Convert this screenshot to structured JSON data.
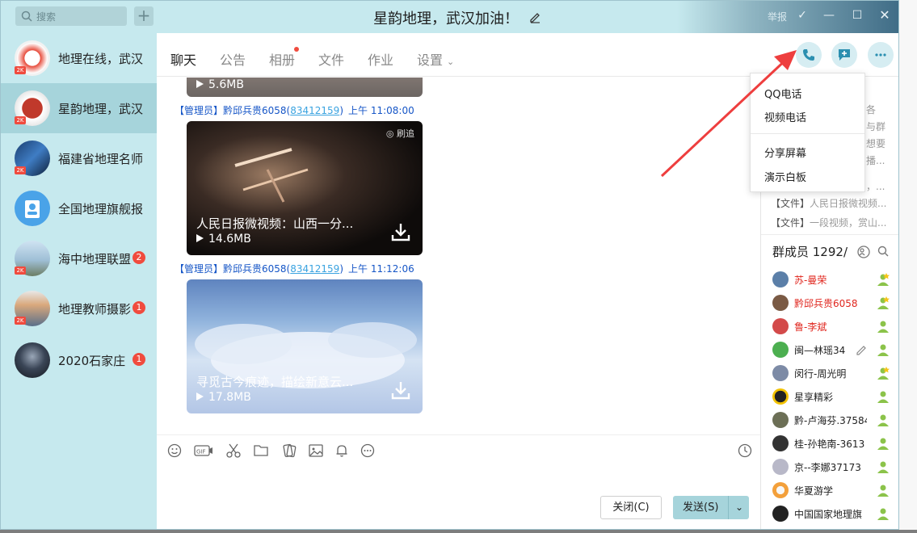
{
  "search": {
    "placeholder": "搜索",
    "add_symbol": "+"
  },
  "conversations": [
    {
      "name": "地理在线，武汉",
      "badge": ""
    },
    {
      "name": "星韵地理，武汉",
      "badge": ""
    },
    {
      "name": "福建省地理名师",
      "badge": ""
    },
    {
      "name": "全国地理旗舰报",
      "badge": ""
    },
    {
      "name": "海中地理联盟",
      "badge": "2"
    },
    {
      "name": "地理教师摄影",
      "badge": "1"
    },
    {
      "name": "2020石家庄",
      "badge": "1"
    }
  ],
  "window": {
    "title": "星韵地理，武汉加油！",
    "report": "举报"
  },
  "tabs": [
    "聊天",
    "公告",
    "相册",
    "文件",
    "作业",
    "设置"
  ],
  "messages": [
    {
      "sender": "【管理员】黔邱兵贵6058",
      "qq": "83412159",
      "time": "上午 11:08:00",
      "video_title": "人民日报微视频：山西一分...",
      "size": "14.6MB",
      "tag": "刷追"
    },
    {
      "sender": "【管理员】黔邱兵贵6058",
      "qq": "83412159",
      "time": "上午 11:12:06",
      "video_title": "寻觅古今痕迹，描绘新意云...",
      "size": "17.8MB"
    }
  ],
  "prev_card_size": "5.6MB",
  "composer": {
    "close": "关闭(C)",
    "send": "发送(S)"
  },
  "menu": {
    "items": [
      "QQ电话",
      "视频电话",
      "分享屏幕",
      "演示白板"
    ]
  },
  "right_panel": {
    "ann_fragments": [
      "各",
      "与群",
      "想要",
      "播...",
      "，..."
    ],
    "files": [
      {
        "tag": "【文件】",
        "text": "人民日报微视频..."
      },
      {
        "tag": "【文件】",
        "text": "一段视频，赏山..."
      }
    ],
    "member_header": "群成员 1292/",
    "members": [
      {
        "name": "苏-曼荣",
        "red": true
      },
      {
        "name": "黔邱兵贵6058",
        "red": true
      },
      {
        "name": "鲁-李斌",
        "red": true
      },
      {
        "name": "闽—林瑶34",
        "red": false
      },
      {
        "name": "闵行-周光明",
        "red": false
      },
      {
        "name": "星享精彩",
        "red": false
      },
      {
        "name": "黔-卢海芬.37584",
        "red": false
      },
      {
        "name": "桂-孙艳南-3613",
        "red": false
      },
      {
        "name": "京--李娜37173",
        "red": false
      },
      {
        "name": "华夏游学",
        "red": false
      },
      {
        "name": "中国国家地理旗",
        "red": false
      }
    ]
  },
  "colors": {
    "sidebar": "#c6e9ee",
    "accent": "#a6d4db",
    "badge": "#f04b3e",
    "admin": "#1656c7",
    "arrow": "#ee3e3e"
  }
}
